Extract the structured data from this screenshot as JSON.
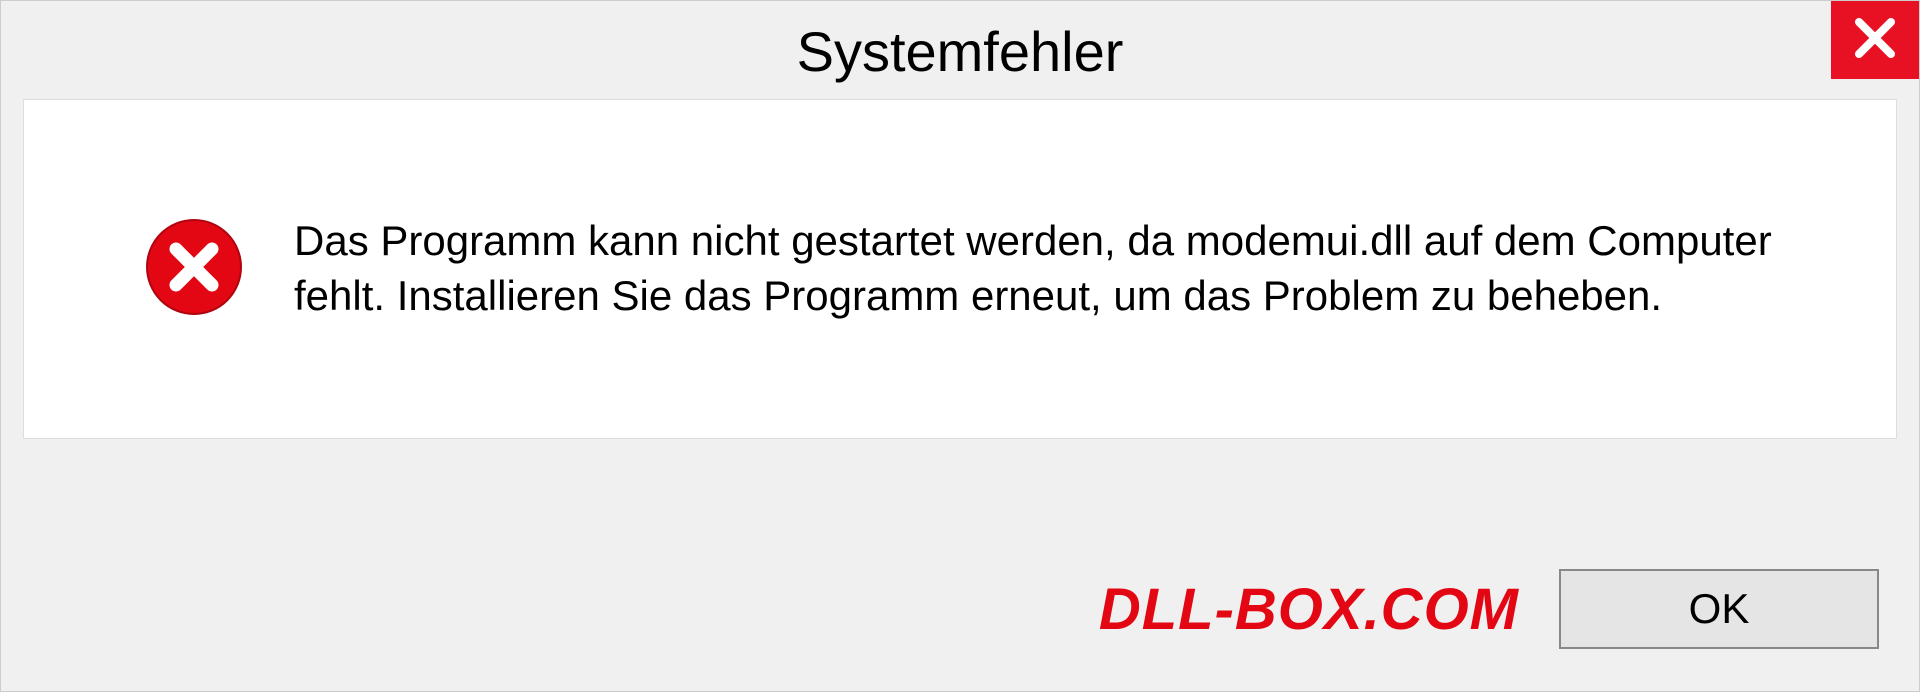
{
  "dialog": {
    "title": "Systemfehler",
    "message": "Das Programm kann nicht gestartet werden, da modemui.dll auf dem Computer fehlt. Installieren Sie das Programm erneut, um das Problem zu beheben.",
    "ok_label": "OK"
  },
  "watermark": "DLL-BOX.COM",
  "colors": {
    "close_bg": "#e81123",
    "error_red": "#e30613",
    "watermark_red": "#e30613"
  }
}
